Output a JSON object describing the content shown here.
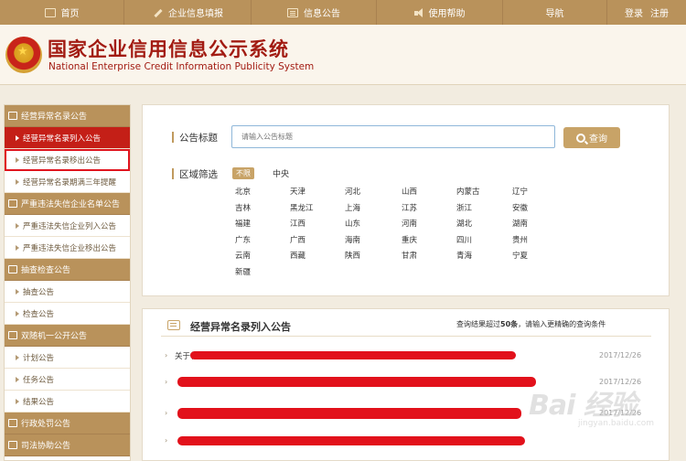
{
  "topnav": {
    "items": [
      "首页",
      "企业信息填报",
      "信息公告",
      "使用帮助",
      "导航"
    ],
    "login": "登录",
    "register": "注册"
  },
  "header": {
    "title": "国家企业信用信息公示系统",
    "subtitle": "National Enterprise Credit Information Publicity System"
  },
  "sidebar": {
    "sections": [
      {
        "title": "经营异常名录公告",
        "items": [
          "经营异常名录列入公告",
          "经营异常名录移出公告",
          "经营异常名录期满三年提醒"
        ]
      },
      {
        "title": "严重违法失信企业名单公告",
        "items": [
          "严重违法失信企业列入公告",
          "严重违法失信企业移出公告"
        ]
      },
      {
        "title": "抽查检查公告",
        "items": [
          "抽查公告",
          "检查公告"
        ]
      },
      {
        "title": "双随机一公开公告",
        "items": [
          "计划公告",
          "任务公告",
          "结果公告"
        ]
      },
      {
        "title": "行政处罚公告",
        "items": []
      },
      {
        "title": "司法协助公告",
        "items": []
      }
    ]
  },
  "search": {
    "label": "公告标题",
    "placeholder": "请输入公告标题",
    "button": "查询",
    "region_label": "区域筛选",
    "tag_all": "不限",
    "tag_central": "中央",
    "regions": [
      "北京",
      "天津",
      "河北",
      "山西",
      "内蒙古",
      "辽宁",
      "吉林",
      "黑龙江",
      "上海",
      "江苏",
      "浙江",
      "安徽",
      "福建",
      "江西",
      "山东",
      "河南",
      "湖北",
      "湖南",
      "广东",
      "广西",
      "海南",
      "重庆",
      "四川",
      "贵州",
      "云南",
      "西藏",
      "陕西",
      "甘肃",
      "青海",
      "宁夏",
      "新疆"
    ]
  },
  "results": {
    "title": "经营异常名录列入公告",
    "note_prefix": "查询结果超过",
    "note_count": "50条",
    "note_suffix": "，请输入更精确的查询条件",
    "rows": [
      {
        "text": "关于将",
        "date": "2017/12/26"
      },
      {
        "text": "",
        "date": "2017/12/26"
      },
      {
        "text": "",
        "date": "2017/12/26"
      },
      {
        "text": "",
        "date": ""
      }
    ]
  },
  "watermark": {
    "text": "Bai 经验",
    "sub": "jingyan.baidu.com"
  },
  "colors": {
    "nav": "#b9925b",
    "accent": "#c8a367",
    "active": "#c41f17",
    "title": "#a21b12"
  }
}
